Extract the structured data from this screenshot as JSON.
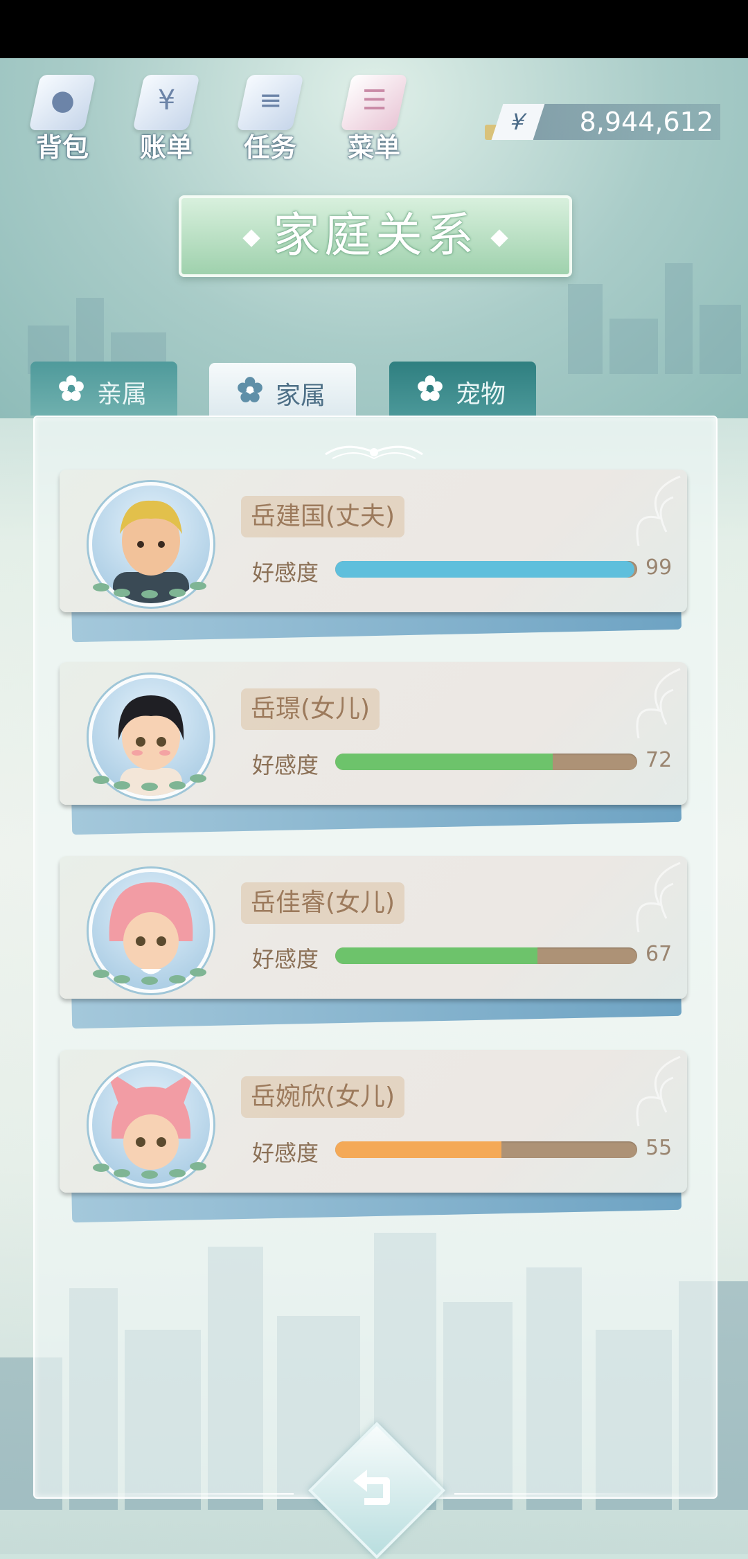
{
  "nav": {
    "items": [
      {
        "label": "背包",
        "icon": "bag-icon"
      },
      {
        "label": "账单",
        "icon": "bill-icon"
      },
      {
        "label": "任务",
        "icon": "task-icon"
      },
      {
        "label": "菜单",
        "icon": "menu-icon"
      }
    ]
  },
  "currency": {
    "symbol": "¥",
    "amount": "8,944,612"
  },
  "title": "家庭关系",
  "tabs": [
    {
      "label": "亲属",
      "active": false
    },
    {
      "label": "家属",
      "active": true
    },
    {
      "label": "宠物",
      "active": false
    }
  ],
  "relations": [
    {
      "name": "岳建国(丈夫)",
      "affinity_label": "好感度",
      "affinity": 99,
      "bar_color": "#5fbfdc"
    },
    {
      "name": "岳璟(女儿)",
      "affinity_label": "好感度",
      "affinity": 72,
      "bar_color": "#6dc36b"
    },
    {
      "name": "岳佳睿(女儿)",
      "affinity_label": "好感度",
      "affinity": 67,
      "bar_color": "#6dc36b"
    },
    {
      "name": "岳婉欣(女儿)",
      "affinity_label": "好感度",
      "affinity": 55,
      "bar_color": "#f4a957"
    }
  ],
  "colors": {
    "accent": "#9fd1ad",
    "bar_track": "#ad9276"
  }
}
